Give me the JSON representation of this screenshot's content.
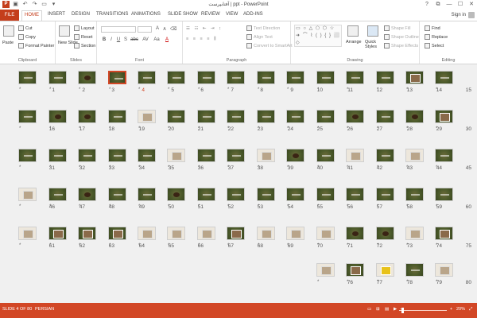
{
  "window": {
    "title": "آفتابپرست | ppt - PowerPoint",
    "qat_icons": [
      "powerpoint-app-icon",
      "save-icon",
      "undo-icon",
      "redo-icon",
      "presenter-icon",
      "customize-icon"
    ],
    "controls": [
      "?",
      "⧉",
      "—",
      "☐",
      "✕"
    ]
  },
  "tabs": [
    {
      "label": "FILE",
      "key": "file"
    },
    {
      "label": "HOME",
      "key": "home",
      "active": true
    },
    {
      "label": "INSERT",
      "key": "insert"
    },
    {
      "label": "DESIGN",
      "key": "design"
    },
    {
      "label": "TRANSITIONS",
      "key": "transitions"
    },
    {
      "label": "ANIMATIONS",
      "key": "animations"
    },
    {
      "label": "SLIDE SHOW",
      "key": "slide-show"
    },
    {
      "label": "REVIEW",
      "key": "review"
    },
    {
      "label": "VIEW",
      "key": "view"
    },
    {
      "label": "ADD-INS",
      "key": "add-ins"
    }
  ],
  "account": {
    "signin": "Sign in"
  },
  "ribbon": {
    "clipboard": {
      "label": "Clipboard",
      "paste": "Paste",
      "cut": "Cut",
      "copy": "Copy",
      "format_painter": "Format Painter"
    },
    "slides": {
      "label": "Slides",
      "new_slide": "New Slide",
      "layout": "Layout",
      "reset": "Reset",
      "section": "Section"
    },
    "font": {
      "label": "Font",
      "bold": "B",
      "italic": "I",
      "underline": "U",
      "shadow": "S",
      "strike": "abc",
      "spacing": "AV",
      "case": "Aa",
      "color": "A",
      "grow": "A",
      "shrink": "A",
      "clear": "⌫"
    },
    "paragraph": {
      "label": "Paragraph",
      "text_direction": "Text Direction",
      "align_text": "Align Text",
      "convert_smartart": "Convert to SmartArt"
    },
    "drawing": {
      "label": "Drawing",
      "shapes_glyphs": "▭ ○ △ ⬠ ⬡ ☆ ➜ ⌒ ⌇ ( ) { } ⬜ ◇",
      "arrange": "Arrange",
      "quick_styles": "Quick Styles",
      "shape_fill": "Shape Fill",
      "shape_outline": "Shape Outline",
      "shape_effects": "Shape Effects"
    },
    "editing": {
      "label": "Editing",
      "find": "Find",
      "replace": "Replace",
      "select": "Select"
    }
  },
  "slides": [
    {
      "num": "15",
      "s": "d"
    },
    {
      "num": "14",
      "s": "p"
    },
    {
      "num": "13",
      "s": "d"
    },
    {
      "num": "12",
      "s": "d"
    },
    {
      "num": "11",
      "s": "d"
    },
    {
      "num": "10",
      "s": "d"
    },
    {
      "num": "9",
      "s": "d"
    },
    {
      "num": "8",
      "s": "d"
    },
    {
      "num": "7",
      "s": "d"
    },
    {
      "num": "6",
      "s": "d"
    },
    {
      "num": "5",
      "s": "d"
    },
    {
      "num": "4",
      "s": "d",
      "selected": true
    },
    {
      "num": "3",
      "s": "b"
    },
    {
      "num": "2",
      "s": "d"
    },
    {
      "num": "1",
      "s": "d"
    },
    {
      "num": "30",
      "s": "p"
    },
    {
      "num": "29",
      "s": "b"
    },
    {
      "num": "28",
      "s": "d"
    },
    {
      "num": "27",
      "s": "b"
    },
    {
      "num": "26",
      "s": "d"
    },
    {
      "num": "25",
      "s": "d"
    },
    {
      "num": "24",
      "s": "d"
    },
    {
      "num": "23",
      "s": "d"
    },
    {
      "num": "22",
      "s": "d"
    },
    {
      "num": "21",
      "s": "d"
    },
    {
      "num": "20",
      "s": "l"
    },
    {
      "num": "19",
      "s": "d"
    },
    {
      "num": "18",
      "s": "b"
    },
    {
      "num": "17",
      "s": "b"
    },
    {
      "num": "16",
      "s": "d"
    },
    {
      "num": "45",
      "s": "d"
    },
    {
      "num": "44",
      "s": "l"
    },
    {
      "num": "43",
      "s": "d"
    },
    {
      "num": "42",
      "s": "l"
    },
    {
      "num": "41",
      "s": "d"
    },
    {
      "num": "40",
      "s": "b"
    },
    {
      "num": "39",
      "s": "l"
    },
    {
      "num": "38",
      "s": "d"
    },
    {
      "num": "37",
      "s": "d"
    },
    {
      "num": "36",
      "s": "l"
    },
    {
      "num": "35",
      "s": "d"
    },
    {
      "num": "34",
      "s": "d"
    },
    {
      "num": "33",
      "s": "d"
    },
    {
      "num": "32",
      "s": "d"
    },
    {
      "num": "31",
      "s": "d"
    },
    {
      "num": "60",
      "s": "d"
    },
    {
      "num": "59",
      "s": "d"
    },
    {
      "num": "58",
      "s": "d"
    },
    {
      "num": "57",
      "s": "d"
    },
    {
      "num": "56",
      "s": "d"
    },
    {
      "num": "55",
      "s": "d"
    },
    {
      "num": "54",
      "s": "d"
    },
    {
      "num": "53",
      "s": "d"
    },
    {
      "num": "52",
      "s": "d"
    },
    {
      "num": "51",
      "s": "b"
    },
    {
      "num": "50",
      "s": "d"
    },
    {
      "num": "49",
      "s": "d"
    },
    {
      "num": "48",
      "s": "b"
    },
    {
      "num": "47",
      "s": "d"
    },
    {
      "num": "46",
      "s": "l"
    },
    {
      "num": "75",
      "s": "p"
    },
    {
      "num": "74",
      "s": "l"
    },
    {
      "num": "73",
      "s": "b"
    },
    {
      "num": "72",
      "s": "b"
    },
    {
      "num": "71",
      "s": "l"
    },
    {
      "num": "70",
      "s": "l"
    },
    {
      "num": "69",
      "s": "l"
    },
    {
      "num": "68",
      "s": "p"
    },
    {
      "num": "67",
      "s": "l"
    },
    {
      "num": "66",
      "s": "l"
    },
    {
      "num": "65",
      "s": "l"
    },
    {
      "num": "64",
      "s": "p"
    },
    {
      "num": "63",
      "s": "p"
    },
    {
      "num": "62",
      "s": "p"
    },
    {
      "num": "61",
      "s": "l"
    },
    {
      "num": "80",
      "s": "l"
    },
    {
      "num": "79",
      "s": "d"
    },
    {
      "num": "78",
      "s": "y"
    },
    {
      "num": "77",
      "s": "p"
    },
    {
      "num": "76",
      "s": "l"
    }
  ],
  "status": {
    "slide_info": "SLIDE 4 OF 80",
    "language": "PERSIAN",
    "zoom": "20%",
    "zoom_level": 20
  },
  "colors": {
    "accent": "#d24726",
    "file_tab": "#c43e1c",
    "sorter_bg": "#f0f0f0"
  }
}
